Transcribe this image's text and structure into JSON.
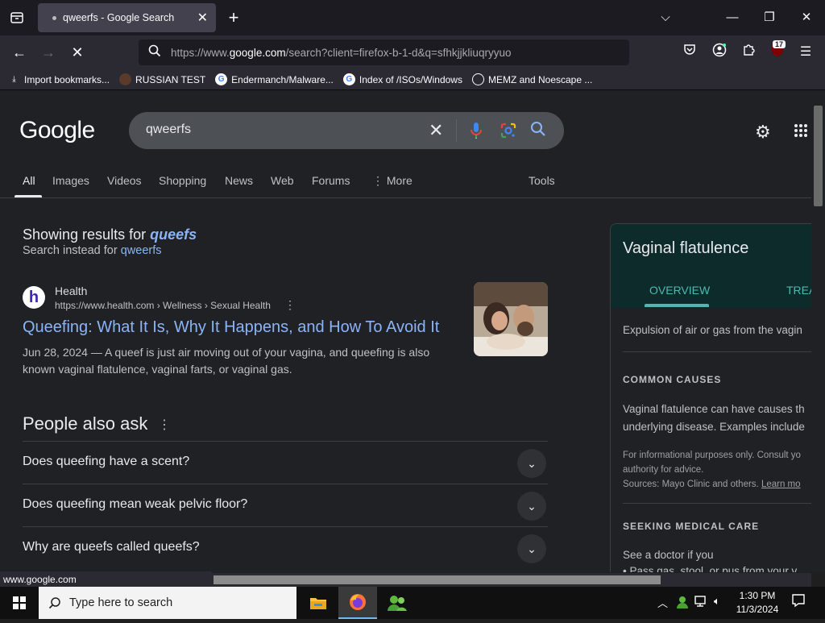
{
  "browser": {
    "tab_title": "qweerfs - Google Search",
    "url_prefix": "https://www.",
    "url_domain": "google.com",
    "url_rest": "/search?client=firefox-b-1-d&q=sfhkjjkliuqryyuo",
    "extension_badge": "17",
    "bookmarks": [
      "Import bookmarks...",
      "RUSSIAN TEST",
      "Endermanch/Malware...",
      "Index of /ISOs/Windows",
      "MEMZ and Noescape ..."
    ],
    "status_url": "www.google.com"
  },
  "search": {
    "logo": "Google",
    "query": "qweerfs",
    "tabs": [
      "All",
      "Images",
      "Videos",
      "Shopping",
      "News",
      "Web",
      "Forums",
      "More"
    ],
    "tools": "Tools"
  },
  "correction": {
    "showing_prefix": "Showing results for",
    "corrected": "queefs",
    "instead_prefix": "Search instead for",
    "original": "qweerfs"
  },
  "result": {
    "favicon_letter": "h",
    "site": "Health",
    "breadcrumb": "https://www.health.com › Wellness › Sexual Health",
    "title": "Queefing: What It Is, Why It Happens, and How To Avoid It",
    "date": "Jun 28, 2024",
    "snippet": " — A queef is just air moving out of your vagina, and queefing is also known vaginal flatulence, vaginal farts, or vaginal gas."
  },
  "people_also_ask": {
    "title": "People also ask",
    "questions": [
      "Does queefing have a scent?",
      "Does queefing mean weak pelvic floor?",
      "Why are queefs called queefs?"
    ]
  },
  "knowledge_panel": {
    "title": "Vaginal flatulence",
    "tab_overview": "OVERVIEW",
    "tab_treatment": "TREA",
    "description": "Expulsion of air or gas from the vagin",
    "causes_heading": "COMMON CAUSES",
    "causes_line1": "Vaginal flatulence can have causes th",
    "causes_line2": "underlying disease. Examples include",
    "disclaimer_line1": "For informational purposes only. Consult yo",
    "disclaimer_line2": "authority for advice.",
    "sources": "Sources: Mayo Clinic and others.",
    "learn_more": "Learn mo",
    "care_heading": "SEEKING MEDICAL CARE",
    "care_line1": "See a doctor if you",
    "care_bullet": "• Pass gas, stool, or pus from your v"
  },
  "taskbar": {
    "search_placeholder": "Type here to search",
    "time": "1:30 PM",
    "date": "11/3/2024"
  }
}
